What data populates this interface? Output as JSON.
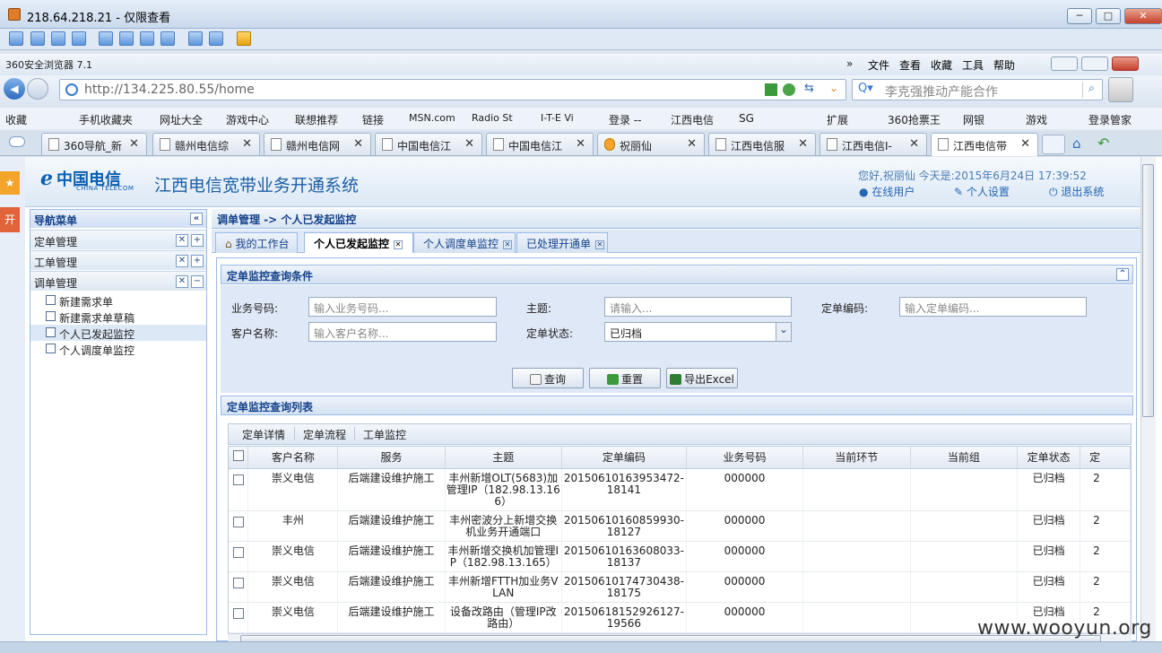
{
  "window": {
    "title": "218.64.218.21 - 仅限查看",
    "minimize": "─",
    "maximize": "□",
    "close": "✕"
  },
  "browser": {
    "name": "360安全浏览器 7.1",
    "menu": [
      "文件",
      "查看",
      "收藏",
      "工具",
      "帮助"
    ],
    "address": "http://134.225.80.55/home",
    "search_placeholder": "李克强推动产能合作",
    "favorites": [
      "收藏",
      "手机收藏夹",
      "网址大全",
      "游戏中心",
      "联想推荐",
      "链接",
      "MSN.com",
      "Radio St",
      "I-T-E Vi",
      "登录 --",
      "江西电信",
      "SG",
      "扩展",
      "360抢票王",
      "网银",
      "游戏",
      "登录管家"
    ],
    "tabs": [
      "360导航_新",
      "赣州电信综",
      "赣州电信网",
      "中国电信江",
      "中国电信江",
      "祝丽仙",
      "江西电信服",
      "江西电信I-",
      "江西电信带"
    ]
  },
  "header": {
    "logo": "中国电信",
    "logo_sub": "CHINA TELECOM",
    "system_name": "江西电信宽带业务开通系统",
    "greeting": "您好,祝丽仙  今天是:2015年6月24日  17:39:52",
    "links": {
      "online": "在线用户",
      "profile": "个人设置",
      "logout": "退出系统"
    }
  },
  "nav": {
    "title": "导航菜单",
    "groups": [
      {
        "label": "定单管理",
        "toggle": "+"
      },
      {
        "label": "工单管理",
        "toggle": "+"
      },
      {
        "label": "调单管理",
        "toggle": "−"
      }
    ],
    "items": [
      "新建需求单",
      "新建需求单草稿",
      "个人已发起监控",
      "个人调度单监控"
    ],
    "side_tab": "开"
  },
  "main": {
    "breadcrumb": "调单管理  -> 个人已发起监控",
    "tabs": [
      "我的工作台",
      "个人已发起监控",
      "个人调度单监控",
      "已处理开通单"
    ],
    "query": {
      "title": "定单监控查询条件",
      "labels": [
        "业务号码:",
        "主题:",
        "定单编码:",
        "客户名称:",
        "定单状态:"
      ],
      "placeholders": [
        "输入业务号码...",
        "请输入...",
        "输入定单编码...",
        "输入客户名称..."
      ],
      "status_value": "已归档",
      "buttons": [
        "查询",
        "重置",
        "导出Excel"
      ]
    },
    "list": {
      "title": "定单监控查询列表",
      "actions": [
        "定单详情",
        "定单流程",
        "工单监控"
      ],
      "columns": [
        "客户名称",
        "服务",
        "主题",
        "定单编码",
        "业务号码",
        "当前环节",
        "当前组",
        "定单状态",
        "定"
      ],
      "rows": [
        [
          "崇义电信",
          "后端建设维护施工",
          "丰州新增OLT(5683)加管理IP（182.98.13.166）",
          "20150610163953472-18141",
          "000000",
          "",
          "",
          "已归档",
          "2"
        ],
        [
          "丰州",
          "后端建设维护施工",
          "丰州密波分上新增交换机业务开通端口",
          "20150610160859930-18127",
          "000000",
          "",
          "",
          "已归档",
          "2"
        ],
        [
          "崇义电信",
          "后端建设维护施工",
          "丰州新增交换机加管理IP（182.98.13.165）",
          "20150610163608033-18137",
          "000000",
          "",
          "",
          "已归档",
          "2"
        ],
        [
          "崇义电信",
          "后端建设维护施工",
          "丰州新增FTTH加业务VLAN",
          "20150610174730438-18175",
          "000000",
          "",
          "",
          "已归档",
          "2"
        ],
        [
          "崇义电信",
          "后端建设维护施工",
          "设备改路由（管理IP改路由）",
          "20150618152926127-19566",
          "000000",
          "",
          "",
          "已归档",
          "2"
        ]
      ]
    }
  },
  "watermark": "www.wooyun.org",
  "colors": {
    "accent": "#15428b",
    "panel_border": "#99bbe8",
    "brand": "#0b5fb1"
  }
}
